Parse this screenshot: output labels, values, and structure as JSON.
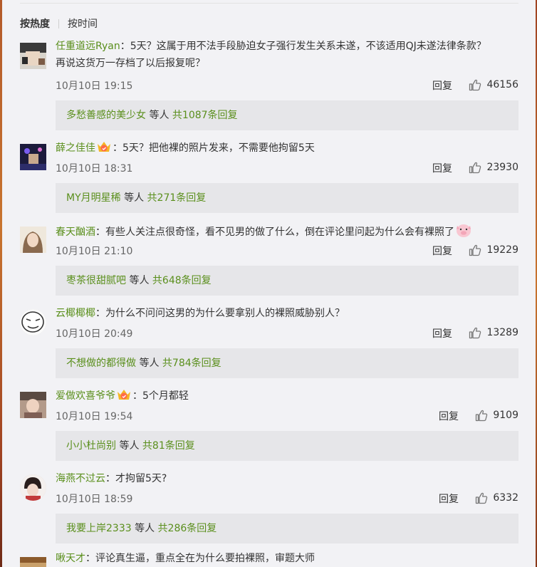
{
  "sort": {
    "hot_label": "按热度",
    "time_label": "按时间"
  },
  "comments": [
    {
      "user": "任重道远Ryan",
      "text": "：5天？这属于用不法手段胁迫女子强行发生关系未遂，不该适用QJ未遂法律条款？",
      "text2": "再说这货万一存档了以后报复呢？",
      "date": "10月10日 19:15",
      "reply": "回复",
      "likes": "46156",
      "sub_user": "多愁善感的美少女",
      "sub_mid": " 等人 ",
      "sub_count": "共1087条回复"
    },
    {
      "user": "薛之佳佳",
      "text": "：5天？把他裸的照片发来，不需要他拘留5天",
      "date": "10月10日 18:31",
      "reply": "回复",
      "likes": "23930",
      "sub_user": "MY月明星稀",
      "sub_mid": " 等人 ",
      "sub_count": "共271条回复"
    },
    {
      "user": "春天酗酒",
      "text": "：有些人关注点很奇怪，看不见男的做了什么，倒在评论里问起为什么会有裸照了",
      "date": "10月10日 21:10",
      "reply": "回复",
      "likes": "19229",
      "sub_user": "枣茶很甜腻吧",
      "sub_mid": " 等人 ",
      "sub_count": "共648条回复"
    },
    {
      "user": "云椰椰椰",
      "text": "：为什么不问问这男的为什么要拿别人的裸照威胁别人？",
      "date": "10月10日 20:49",
      "reply": "回复",
      "likes": "13289",
      "sub_user": "不想做的都得做",
      "sub_mid": " 等人 ",
      "sub_count": "共784条回复"
    },
    {
      "user": "爱做欢喜爷爷",
      "text": "：5个月都轻",
      "date": "10月10日 19:54",
      "reply": "回复",
      "likes": "9109",
      "sub_user": "小小杜尚别",
      "sub_mid": " 等人 ",
      "sub_count": "共81条回复"
    },
    {
      "user": "海燕不过云",
      "text": "：才拘留5天?",
      "date": "10月10日 18:59",
      "reply": "回复",
      "likes": "6332",
      "sub_user": "我要上岸2333",
      "sub_mid": " 等人 ",
      "sub_count": "共286条回复"
    },
    {
      "user": "啾天才",
      "text": "：评论真生逼，重点全在为什么要拍裸照，审题大师"
    }
  ]
}
